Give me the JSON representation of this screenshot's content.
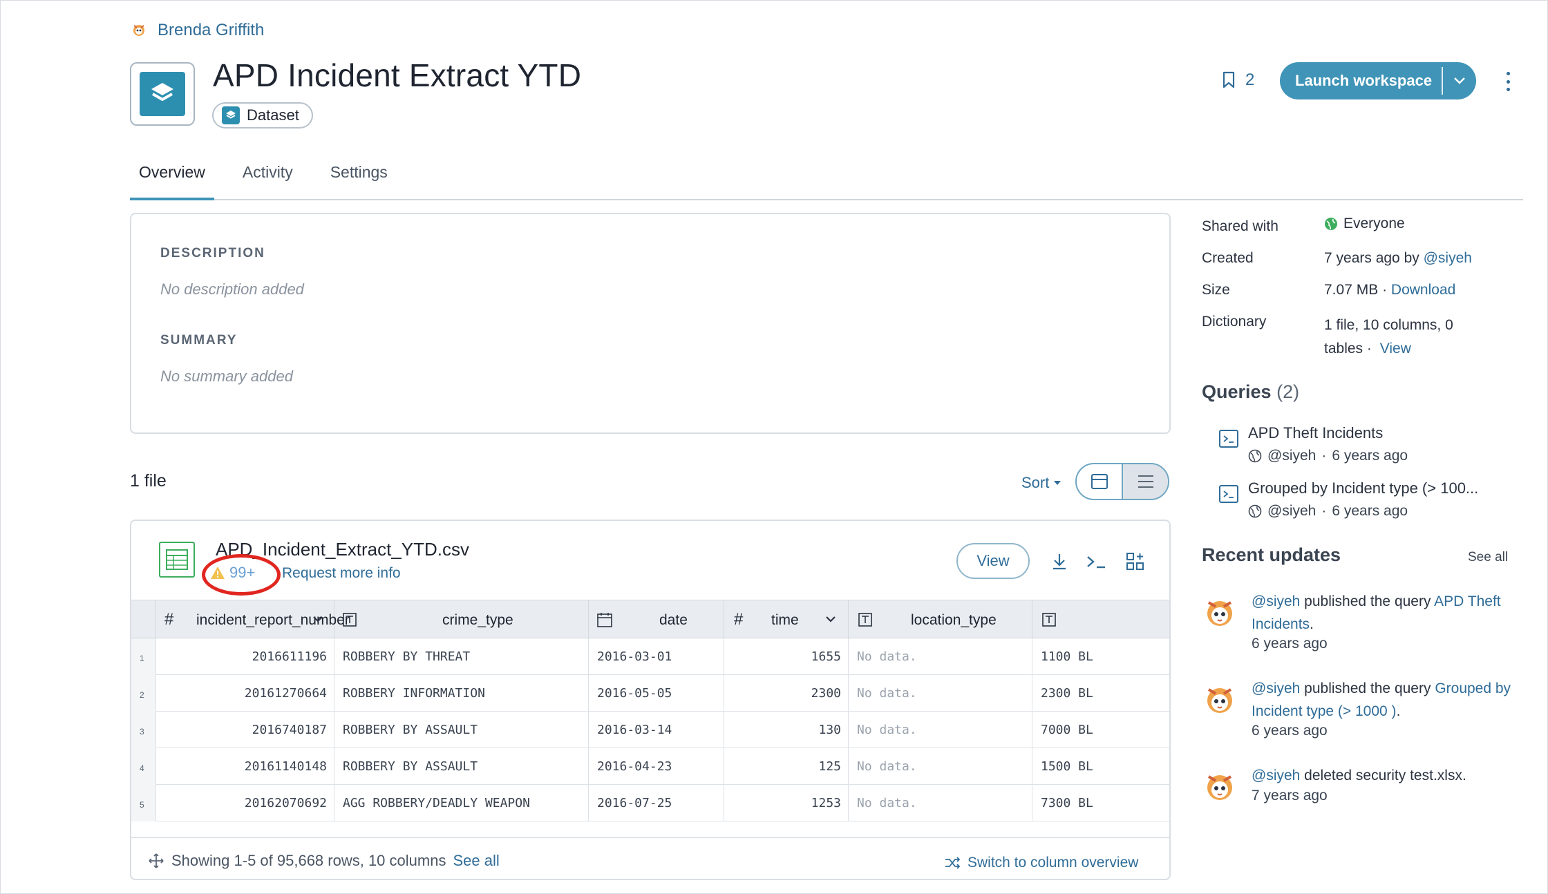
{
  "owner": {
    "name": "Brenda Griffith"
  },
  "dataset": {
    "title": "APD Incident Extract YTD",
    "type_label": "Dataset"
  },
  "header": {
    "bookmark_count": "2",
    "launch_label": "Launch workspace"
  },
  "tabs": [
    {
      "label": "Overview",
      "active": true
    },
    {
      "label": "Activity",
      "active": false
    },
    {
      "label": "Settings",
      "active": false
    }
  ],
  "description": {
    "label": "DESCRIPTION",
    "value": "No description added",
    "summary_label": "SUMMARY",
    "summary_value": "No summary added"
  },
  "files": {
    "count_label": "1 file",
    "sort_label": "Sort"
  },
  "file": {
    "name": "APD_Incident_Extract_YTD.csv",
    "issues_count": "99+",
    "request_info": "Request more info",
    "view_label": "View",
    "columns": [
      {
        "type_icon": "#",
        "name": "incident_report_number",
        "sortable": true
      },
      {
        "type_icon": "T",
        "name": "crime_type",
        "sortable": false
      },
      {
        "type_icon": "calendar",
        "name": "date",
        "sortable": false
      },
      {
        "type_icon": "#",
        "name": "time",
        "sortable": true
      },
      {
        "type_icon": "T",
        "name": "location_type",
        "sortable": false
      },
      {
        "type_icon": "T",
        "name": "",
        "sortable": false
      }
    ],
    "rows": [
      {
        "n": "1",
        "incident": "2016611196",
        "crime": "ROBBERY BY THREAT",
        "date": "2016-03-01",
        "time": "1655",
        "loc": "No data.",
        "addr": "1100 BL"
      },
      {
        "n": "2",
        "incident": "20161270664",
        "crime": "ROBBERY INFORMATION",
        "date": "2016-05-05",
        "time": "2300",
        "loc": "No data.",
        "addr": "2300 BL"
      },
      {
        "n": "3",
        "incident": "2016740187",
        "crime": "ROBBERY BY ASSAULT",
        "date": "2016-03-14",
        "time": "130",
        "loc": "No data.",
        "addr": "7000 BL"
      },
      {
        "n": "4",
        "incident": "20161140148",
        "crime": "ROBBERY BY ASSAULT",
        "date": "2016-04-23",
        "time": "125",
        "loc": "No data.",
        "addr": "1500 BL"
      },
      {
        "n": "5",
        "incident": "20162070692",
        "crime": "AGG ROBBERY/DEADLY WEAPON",
        "date": "2016-07-25",
        "time": "1253",
        "loc": "No data.",
        "addr": "7300 BL"
      }
    ],
    "footer_text": "Showing 1-5 of 95,668 rows, 10 columns",
    "see_all_label": "See all",
    "switch_label": "Switch to column overview"
  },
  "sidebar": {
    "shared_label": "Shared with",
    "shared_value": "Everyone",
    "created_label": "Created",
    "created_value": "7 years ago by",
    "created_user": "@siyeh",
    "size_label": "Size",
    "size_value": "7.07 MB",
    "size_sep": "·",
    "download_label": "Download",
    "dictionary_label": "Dictionary",
    "dictionary_value_1": "1 file, 10 columns, 0",
    "dictionary_value_2": "tables",
    "dictionary_sep": "·",
    "view_label": "View",
    "queries_heading": "Queries",
    "queries_count": "(2)",
    "queries": [
      {
        "title": "APD Theft Incidents",
        "user": "@siyeh",
        "sep": "·",
        "time": "6 years ago"
      },
      {
        "title": "Grouped by Incident type (> 100...",
        "user": "@siyeh",
        "sep": "·",
        "time": "6 years ago"
      }
    ],
    "updates_heading": "Recent updates",
    "see_all_label": "See all",
    "updates": [
      {
        "user": "@siyeh",
        "action": " published the query ",
        "target": "APD Theft Incidents",
        "end": ".",
        "time": "6 years ago"
      },
      {
        "user": "@siyeh",
        "action": " published the query ",
        "target": "Grouped by Incident type (> 1000 )",
        "end": ".",
        "time": "6 years ago"
      },
      {
        "user": "@siyeh",
        "action": " deleted security test.xlsx.",
        "target": "",
        "end": "",
        "time": "7 years ago"
      }
    ]
  },
  "colors": {
    "accent": "#3f94b7",
    "link": "#2f6c98",
    "highlight_circle": "#e0261f",
    "file_icon": "#3dae5e"
  }
}
